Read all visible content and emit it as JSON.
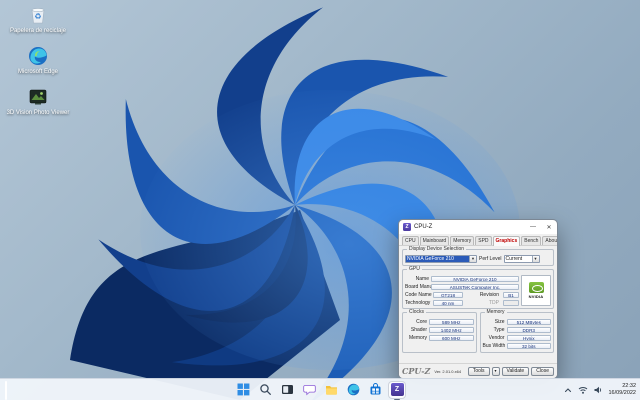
{
  "desktop": {
    "icons": [
      {
        "label": "Papelera de reciclaje"
      },
      {
        "label": "Microsoft Edge"
      },
      {
        "label": "3D Vision Photo Viewer"
      }
    ]
  },
  "cpuz": {
    "title": "CPU-Z",
    "window_controls": {
      "minimize": "—",
      "close": "✕"
    },
    "tabs": [
      "CPU",
      "Mainboard",
      "Memory",
      "SPD",
      "Graphics",
      "Bench",
      "About"
    ],
    "selected_tab": "Graphics",
    "display_selection": {
      "group_label": "Display Device Selection",
      "device": "NVIDIA GeForce 210",
      "perf_level_label": "Perf Level",
      "perf_level": "Current"
    },
    "gpu": {
      "group_label": "GPU",
      "name_label": "Name",
      "name": "NVIDIA GeForce 210",
      "board_label": "Board Manuf.",
      "board": "ASUSTeK Computer Inc.",
      "code_label": "Code Name",
      "code": "GT218",
      "revision_label": "Revision",
      "revision": "B1",
      "tech_label": "Technology",
      "tech": "40 nm",
      "tdp_label": "TDP",
      "tdp": "",
      "vendor_logo": "NVIDIA"
    },
    "clocks": {
      "group_label": "Clocks",
      "rows": [
        {
          "label": "Core",
          "value": "589 MHz"
        },
        {
          "label": "Shader",
          "value": "1402 MHz"
        },
        {
          "label": "Memory",
          "value": "600 MHz"
        }
      ]
    },
    "memory": {
      "group_label": "Memory",
      "rows": [
        {
          "label": "Size",
          "value": "512 MBytes"
        },
        {
          "label": "Type",
          "value": "DDR3"
        },
        {
          "label": "Vendor",
          "value": "Hynix"
        },
        {
          "label": "Bus Width",
          "value": "32 bits"
        }
      ]
    },
    "footer": {
      "logo": "CPU-Z",
      "version": "Ver. 2.01.0.x64",
      "tools_label": "Tools",
      "dropdown_glyph": "▼",
      "validate_label": "Validate",
      "close_label": "Close"
    }
  },
  "taskbar": {
    "tray": {
      "time": "22:32",
      "date": "16/09/2022"
    }
  },
  "colors": {
    "accent_blue": "#2a5ab8",
    "tab_selected_red": "#c00000",
    "nvidia_green": "#76b900",
    "wallpaper_deep_blue": "#0d2f6e"
  }
}
